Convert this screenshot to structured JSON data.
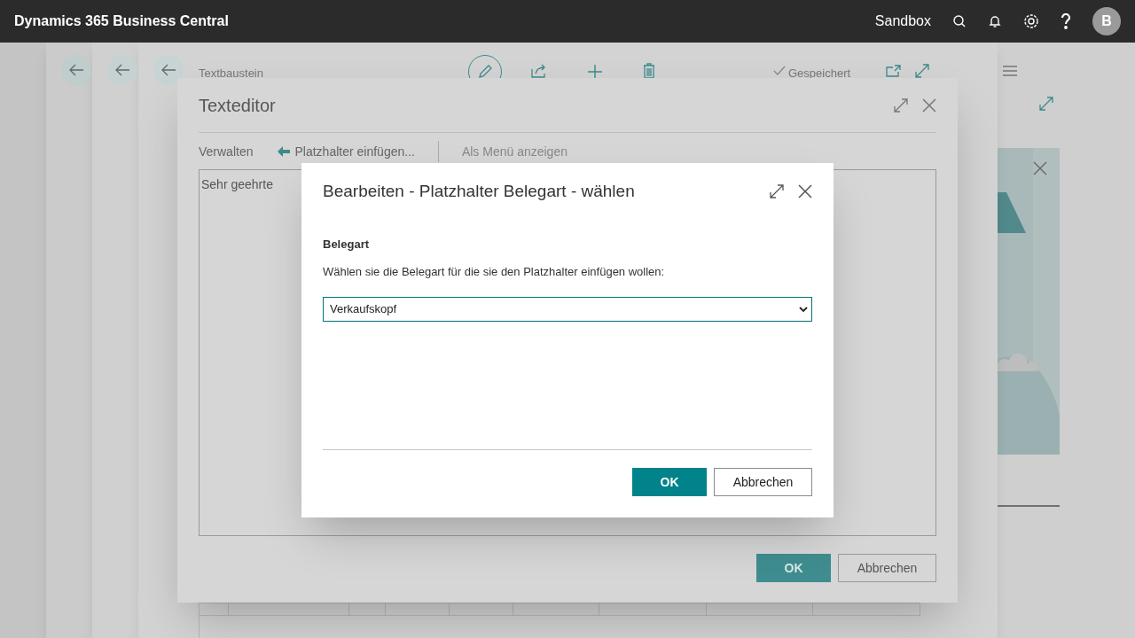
{
  "app_bar": {
    "title": "Dynamics 365 Business Central",
    "environment": "Sandbox",
    "avatar": "B"
  },
  "page": {
    "title": "Textbaustein",
    "status": "Gespeichert"
  },
  "text_editor": {
    "title": "Texteditor",
    "actions": [
      {
        "label": "Verwalten",
        "kind": "menu"
      },
      {
        "label": "Platzhalter einfügen...",
        "kind": "insert"
      },
      {
        "label": "Als Menü anzeigen",
        "kind": "menu"
      }
    ],
    "content": "Sehr geehrte",
    "buttons": [
      {
        "label": "OK",
        "kind": "primary"
      },
      {
        "label": "Abbrechen",
        "kind": "secondary"
      }
    ]
  },
  "dialog": {
    "title": "Bearbeiten - Platzhalter Belegart - wählen",
    "field_label": "Belegart",
    "instruction": "Wählen sie die Belegart für die sie den Platzhalter einfügen wollen:",
    "select": {
      "value": "Verkaufskopf"
    },
    "buttons": [
      {
        "label": "OK",
        "kind": "primary"
      },
      {
        "label": "Abbrechen",
        "kind": "secondary"
      }
    ]
  }
}
